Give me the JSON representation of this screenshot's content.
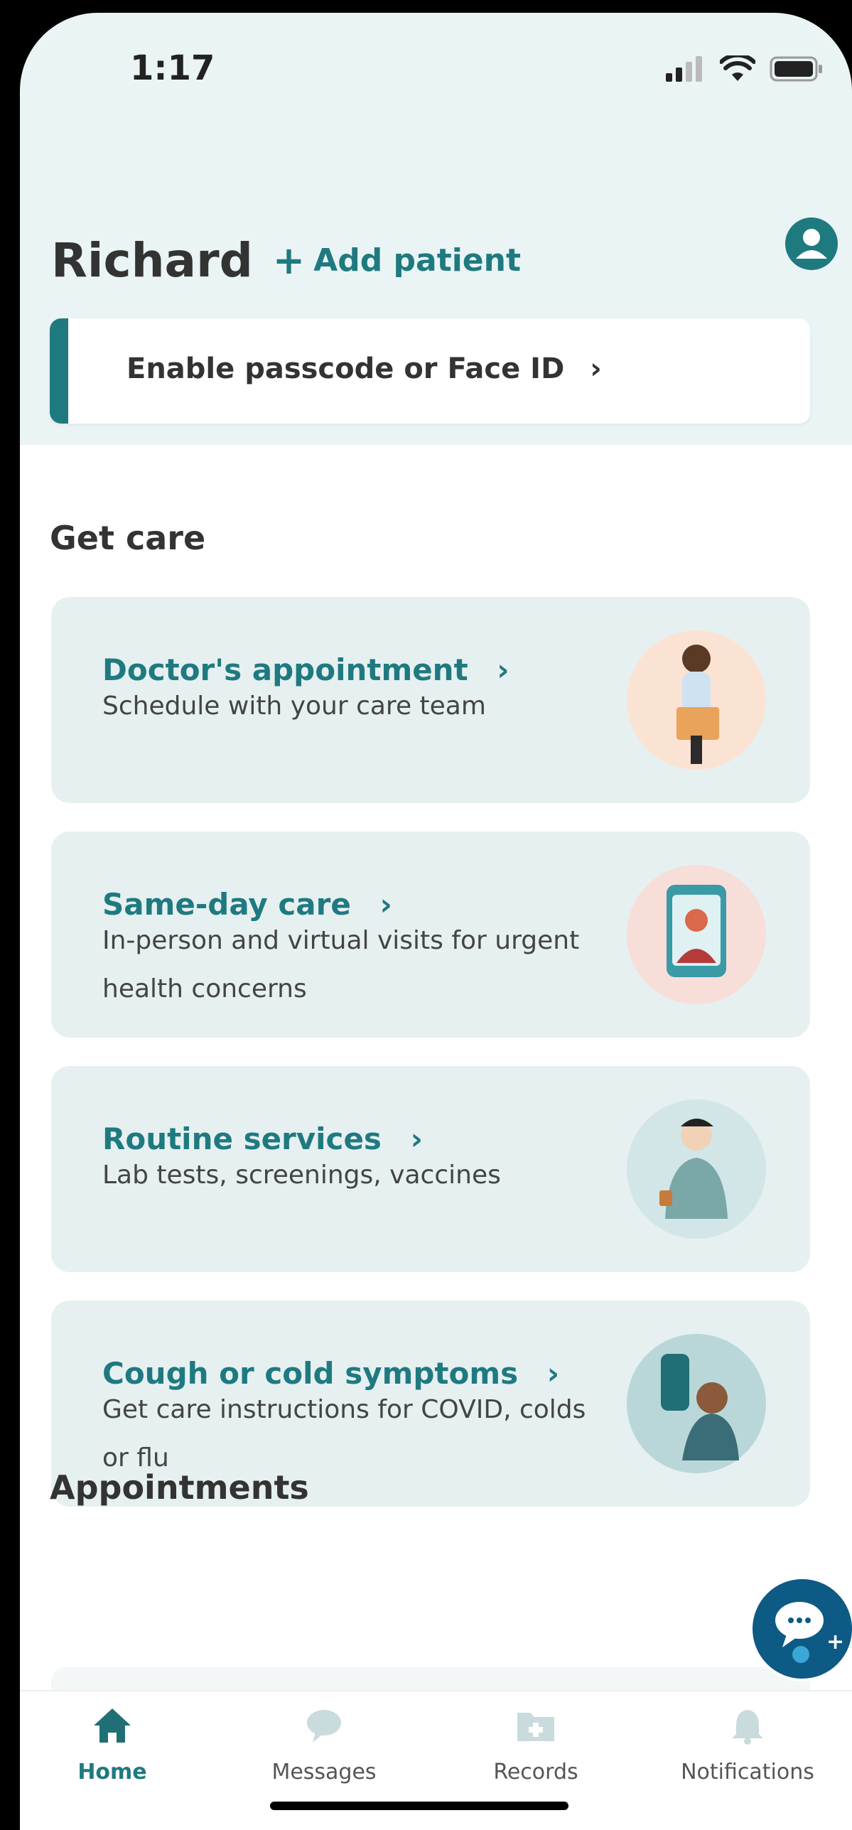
{
  "status_bar": {
    "time": "1:17"
  },
  "header": {
    "patient_name": "Richard",
    "add_patient_label": "Add patient"
  },
  "banner": {
    "text": "Enable passcode or Face ID"
  },
  "get_care": {
    "title": "Get care",
    "cards": [
      {
        "title": "Doctor's appointment",
        "desc_line1": "Schedule with your care team",
        "desc_line2": ""
      },
      {
        "title": "Same-day care",
        "desc_line1": "In-person and virtual visits for urgent",
        "desc_line2": "health concerns"
      },
      {
        "title": "Routine services",
        "desc_line1": "Lab tests, screenings, vaccines",
        "desc_line2": ""
      },
      {
        "title": "Cough or cold symptoms",
        "desc_line1": "Get care instructions for COVID, colds",
        "desc_line2": "or flu"
      }
    ]
  },
  "appointments": {
    "title": "Appointments"
  },
  "nav": {
    "items": [
      {
        "label": "Home",
        "icon": "home-icon",
        "active": true
      },
      {
        "label": "Messages",
        "icon": "chat-icon",
        "active": false
      },
      {
        "label": "Records",
        "icon": "folder-icon",
        "active": false
      },
      {
        "label": "Notifications",
        "icon": "bell-icon",
        "active": false
      }
    ]
  },
  "colors": {
    "accent": "#1f7a80",
    "background": "#eaf4f5",
    "card": "#e6f0f1",
    "fab": "#0d5a85"
  }
}
